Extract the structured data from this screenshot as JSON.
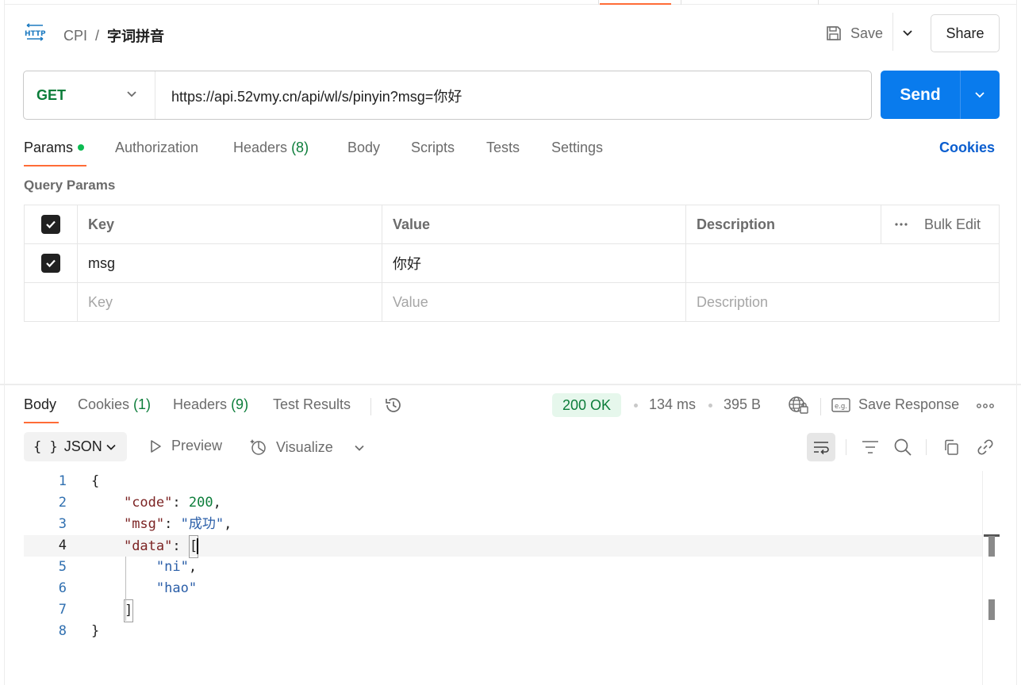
{
  "header": {
    "collection": "CPI",
    "separator": "/",
    "request_name": "字词拼音",
    "save_label": "Save",
    "share_label": "Share"
  },
  "request": {
    "method": "GET",
    "url": "https://api.52vmy.cn/api/wl/s/pinyin?msg=你好",
    "send_label": "Send"
  },
  "request_tabs": {
    "params": "Params",
    "authorization": "Authorization",
    "headers": "Headers",
    "headers_count": "(8)",
    "body": "Body",
    "scripts": "Scripts",
    "tests": "Tests",
    "settings": "Settings",
    "cookies": "Cookies"
  },
  "query_params": {
    "title": "Query Params",
    "columns": {
      "key": "Key",
      "value": "Value",
      "description": "Description",
      "bulk_edit": "Bulk Edit"
    },
    "rows": [
      {
        "key": "msg",
        "value": "你好",
        "description": ""
      }
    ],
    "placeholders": {
      "key": "Key",
      "value": "Value",
      "description": "Description"
    }
  },
  "response_tabs": {
    "body": "Body",
    "cookies": "Cookies",
    "cookies_count": "(1)",
    "headers": "Headers",
    "headers_count": "(9)",
    "test_results": "Test Results",
    "status": "200 OK",
    "time": "134 ms",
    "size": "395 B",
    "save_response": "Save Response"
  },
  "response_toolbar": {
    "format": "JSON",
    "preview": "Preview",
    "visualize": "Visualize"
  },
  "code": {
    "line_numbers": [
      "1",
      "2",
      "3",
      "4",
      "5",
      "6",
      "7",
      "8"
    ],
    "lines": {
      "l1": "{",
      "l2_key": "\"code\"",
      "l2_sep": ": ",
      "l2_val": "200",
      "l2_end": ",",
      "l3_key": "\"msg\"",
      "l3_sep": ": ",
      "l3_val": "\"成功\"",
      "l3_end": ",",
      "l4_key": "\"data\"",
      "l4_sep": ": ",
      "l4_open": "[",
      "l5_val": "\"ni\"",
      "l5_end": ",",
      "l6_val": "\"hao\"",
      "l7": "]",
      "l8": "}"
    }
  },
  "colors": {
    "accent_orange": "#ff6c37",
    "send_blue": "#097bed",
    "method_green": "#0c7d3a",
    "link_blue": "#0b5ecf"
  }
}
